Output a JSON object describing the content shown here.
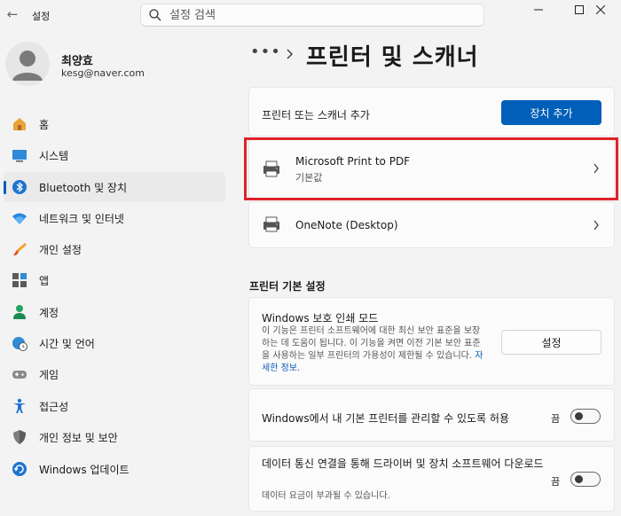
{
  "window": {
    "title": "설정",
    "search_placeholder": "설정 검색"
  },
  "profile": {
    "name": "최양효",
    "email": "kesg@naver.com"
  },
  "sidebar": {
    "items": [
      {
        "label": "홈",
        "icon": "home-icon"
      },
      {
        "label": "시스템",
        "icon": "system-icon"
      },
      {
        "label": "Bluetooth 및 장치",
        "icon": "bluetooth-icon",
        "selected": true
      },
      {
        "label": "네트워크 및 인터넷",
        "icon": "wifi-icon"
      },
      {
        "label": "개인 설정",
        "icon": "brush-icon"
      },
      {
        "label": "앱",
        "icon": "apps-icon"
      },
      {
        "label": "계정",
        "icon": "account-icon"
      },
      {
        "label": "시간 및 언어",
        "icon": "globe-clock-icon"
      },
      {
        "label": "게임",
        "icon": "gamepad-icon"
      },
      {
        "label": "접근성",
        "icon": "accessibility-icon"
      },
      {
        "label": "개인 정보 및 보안",
        "icon": "shield-icon"
      },
      {
        "label": "Windows 업데이트",
        "icon": "update-icon"
      }
    ]
  },
  "main": {
    "breadcrumb_more": "•••",
    "page_title": "프린터 및 스캐너",
    "add_device": {
      "label": "프린터 또는 스캐너 추가",
      "button": "장치 추가"
    },
    "devices": [
      {
        "name": "Microsoft Print to PDF",
        "status": "기본값"
      },
      {
        "name": "OneNote (Desktop)",
        "status": ""
      }
    ],
    "section_title": "프린터 기본 설정",
    "protected_print": {
      "title": "Windows 보호 인쇄 모드",
      "desc": "이 기능은 프린터 소프트웨어에 대한 최신 보안 표준을 보장하는 데 도움이 됩니다. 이 기능을 켜면 이전 기본 보안 표준을 사용하는 일부 프린터의 가용성이 제한될 수 있습니다.",
      "link": "자세한 정보.",
      "button": "설정"
    },
    "manage_default": {
      "label": "Windows에서 내 기본 프린터를 관리할 수 있도록 허용",
      "state": "끔",
      "on": false
    },
    "metered": {
      "label": "데이터 통신 연결을 통해 드라이버 및 장치 소프트웨어 다운로드",
      "desc": "데이터 요금이 부과될 수 있습니다.",
      "state": "끔",
      "on": false
    }
  },
  "colors": {
    "accent": "#005fb8",
    "highlight": "#e0222a"
  }
}
